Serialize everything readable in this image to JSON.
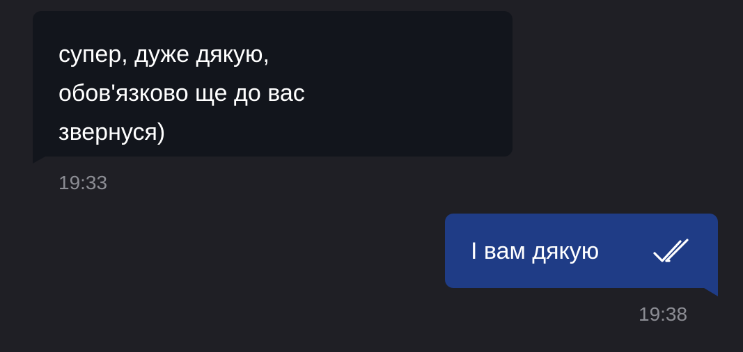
{
  "messages": {
    "incoming": {
      "text": "супер, дуже дякую,\nобов'язково ще до вас\nзвернуся)",
      "time": "19:33"
    },
    "outgoing": {
      "text": "І вам дякую",
      "time": "19:38",
      "status_icon": "double-check-icon"
    }
  },
  "colors": {
    "background": "#1f1f25",
    "incoming_bubble": "#12151c",
    "outgoing_bubble": "#1f3c86",
    "timestamp": "#8c8d94",
    "text": "#ffffff"
  }
}
